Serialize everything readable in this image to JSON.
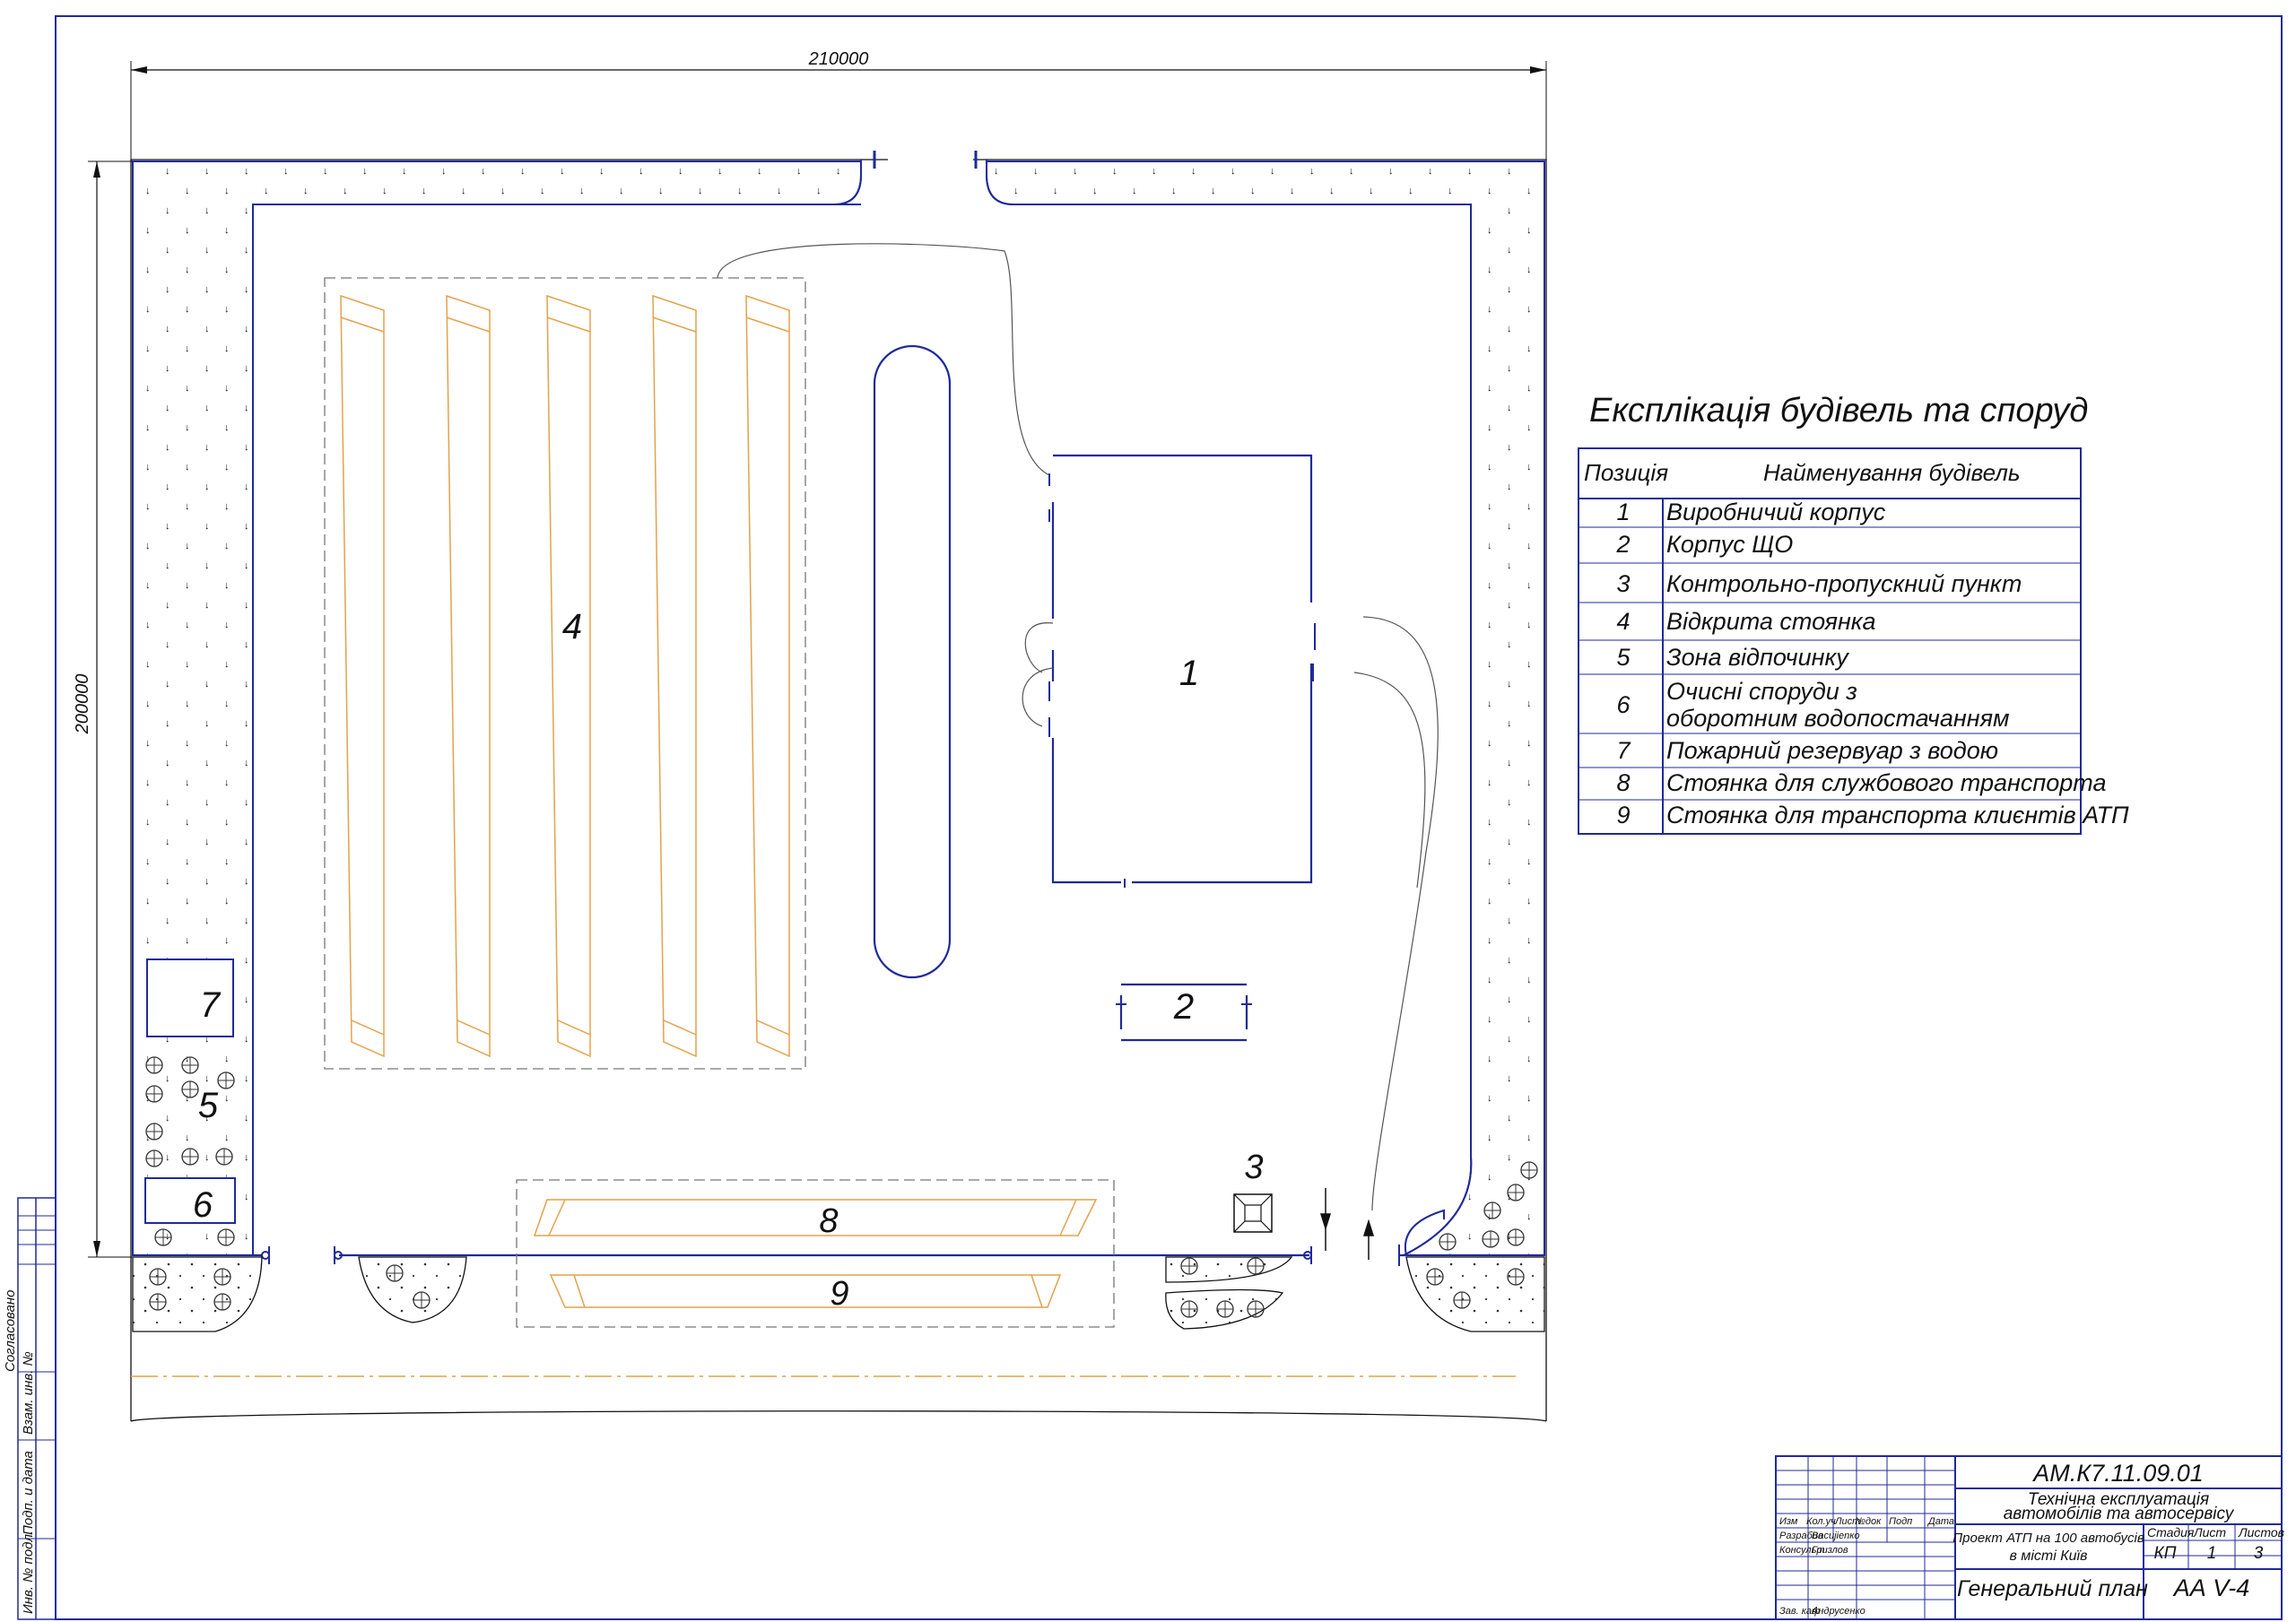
{
  "dimensions": {
    "width_label": "210000",
    "height_label": "200000"
  },
  "position_labels": [
    "1",
    "2",
    "3",
    "4",
    "5",
    "6",
    "7",
    "8",
    "9"
  ],
  "explication": {
    "title": "Експлікація будівель та споруд",
    "header": {
      "position": "Позиція",
      "name": "Найменування будівель"
    },
    "rows": [
      {
        "pos": "1",
        "name": "Виробничий корпус"
      },
      {
        "pos": "2",
        "name": "Корпус ЩО"
      },
      {
        "pos": "3",
        "name": "Контрольно-пропускний пункт"
      },
      {
        "pos": "4",
        "name": "Відкрита стоянка"
      },
      {
        "pos": "5",
        "name": "Зона відпочинку"
      },
      {
        "pos": "6",
        "name": "Очисні споруди з",
        "name2": "оборотним водопостачанням"
      },
      {
        "pos": "7",
        "name": "Пожарний резервуар з водою"
      },
      {
        "pos": "8",
        "name": "Стоянка для службового транспорта"
      },
      {
        "pos": "9",
        "name": "Стоянка для транспорта клиєнтів АТП"
      }
    ]
  },
  "title_block": {
    "code": "АМ.К7.11.09.01",
    "discipline_1": "Технічна експлуатація",
    "discipline_2": "автомобілів та автосервісу",
    "project_1": "Проект АТП на 100 автобусів",
    "project_2": "в місті Київ",
    "sheet_title": "Генеральний план",
    "format": "АА V-4",
    "col_headers": [
      "Изм",
      "Кол.уч",
      "Лист",
      "№док",
      "Подп",
      "Дата"
    ],
    "roles": [
      {
        "role": "Разрабив",
        "person": "Васиjienко"
      },
      {
        "role": "Консульт",
        "person": "Гризлов"
      },
      {
        "role": "Зав. каф",
        "person": "Андрусенко"
      }
    ],
    "stage_headers": [
      "Стадия",
      "Лист",
      "Листов"
    ],
    "stage_values": [
      "КП",
      "1",
      "3"
    ]
  },
  "side_stamp": [
    "Инв. № подл.",
    "Подп. и дата",
    "Взам. инв. №",
    "Согласовано"
  ],
  "colors": {
    "frame": "#1f2a9a",
    "line": "#111111",
    "orange": "#e3a24a",
    "grey": "#777777"
  }
}
